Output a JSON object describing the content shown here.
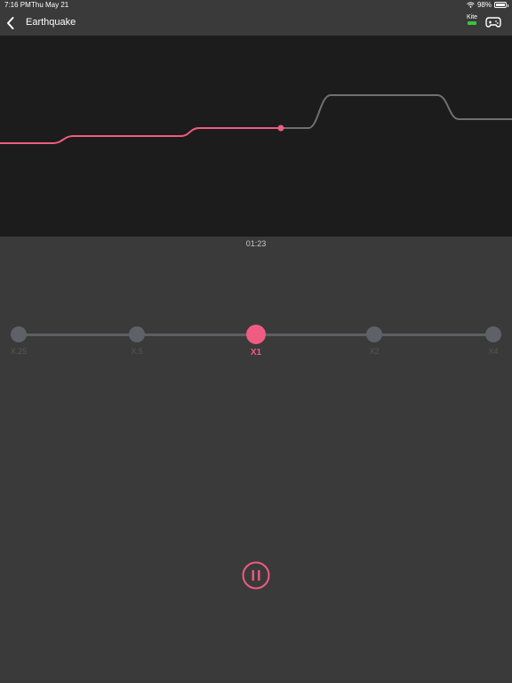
{
  "status_bar": {
    "time": "7:16 PM",
    "date": "Thu May 21",
    "battery": "98%",
    "battery_level": 0.98
  },
  "nav": {
    "title": "Earthquake",
    "device_name": "Kite",
    "back_icon": "chevron-left-icon",
    "gamepad_icon": "gamepad-icon"
  },
  "player": {
    "elapsed": "01:23",
    "progress": 0.55
  },
  "speed": {
    "options": [
      {
        "label": "X.25"
      },
      {
        "label": "X.5"
      },
      {
        "label": "X1"
      },
      {
        "label": "X2"
      },
      {
        "label": "X4"
      }
    ],
    "selected_index": 2
  },
  "controls": {
    "pause_icon": "pause-icon"
  },
  "colors": {
    "accent": "#ef5c82",
    "graph_bg": "#1c1c1c",
    "bg": "#3a3a3a",
    "remaining": "#707070",
    "device_ok": "#38c53a"
  }
}
